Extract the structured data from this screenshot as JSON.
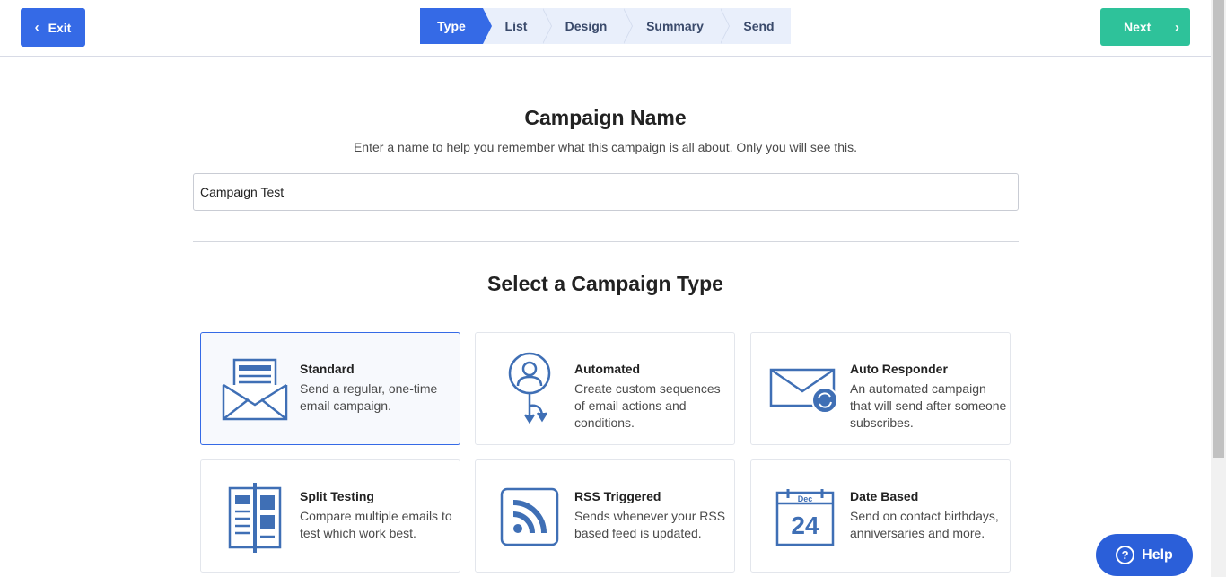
{
  "topbar": {
    "exit_label": "Exit",
    "next_label": "Next",
    "steps": [
      "Type",
      "List",
      "Design",
      "Summary",
      "Send"
    ],
    "active_step": "Type"
  },
  "campaign_name": {
    "title": "Campaign Name",
    "subtitle": "Enter a name to help you remember what this campaign is all about. Only you will see this.",
    "value": "Campaign Test"
  },
  "campaign_type": {
    "title": "Select a Campaign Type",
    "cards": [
      {
        "title": "Standard",
        "desc": "Send a regular, one-time email campaign.",
        "icon": "envelope-open-icon",
        "selected": true
      },
      {
        "title": "Automated",
        "desc": "Create custom sequences of email actions and conditions.",
        "icon": "person-automation-icon"
      },
      {
        "title": "Auto Responder",
        "desc": "An automated campaign that will send after someone subscribes.",
        "icon": "envelope-refresh-icon"
      },
      {
        "title": "Split Testing",
        "desc": "Compare multiple emails to test which work best.",
        "icon": "split-layout-icon"
      },
      {
        "title": "RSS Triggered",
        "desc": "Sends whenever your RSS based feed is updated.",
        "icon": "rss-icon"
      },
      {
        "title": "Date Based",
        "desc": "Send on contact birthdays, anniversaries and more.",
        "icon": "calendar-icon",
        "icon_month": "Dec",
        "icon_day": "24"
      }
    ]
  },
  "help": {
    "label": "Help"
  },
  "colors": {
    "primary": "#356ae6",
    "success": "#2ec29a",
    "icon": "#3f6fb5"
  }
}
